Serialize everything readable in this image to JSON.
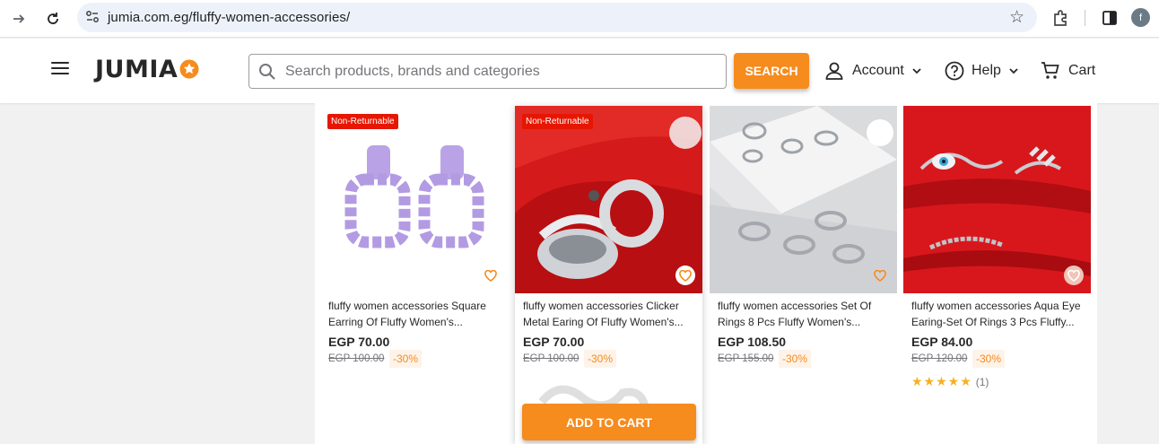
{
  "browser": {
    "url": "jumia.com.eg/fluffy-women-accessories/",
    "profile_initial": "f"
  },
  "header": {
    "logo_text": "JUMIA",
    "search_placeholder": "Search products, brands and categories",
    "search_button": "SEARCH",
    "account_label": "Account",
    "help_label": "Help",
    "cart_label": "Cart"
  },
  "colors": {
    "brand_orange": "#f68b1e",
    "badge_red": "#e61601",
    "text_dark": "#282828"
  },
  "products": [
    {
      "badge": "Non-Returnable",
      "name": "fluffy women accessories Square Earring Of Fluffy Women's...",
      "price": "EGP 70.00",
      "old_price": "EGP 100.00",
      "discount": "-30%"
    },
    {
      "badge": "Non-Returnable",
      "name": "fluffy women accessories Clicker Metal Earing Of Fluffy Women's...",
      "price": "EGP 70.00",
      "old_price": "EGP 100.00",
      "discount": "-30%",
      "add_to_cart": "ADD TO CART"
    },
    {
      "name": "fluffy women accessories Set Of Rings 8 Pcs Fluffy Women's...",
      "price": "EGP 108.50",
      "old_price": "EGP 155.00",
      "discount": "-30%"
    },
    {
      "name": "fluffy women accessories Aqua Eye Earing-Set Of Rings 3 Pcs Fluffy...",
      "price": "EGP 84.00",
      "old_price": "EGP 120.00",
      "discount": "-30%",
      "rating_stars": "★★★★★",
      "rating_count": "(1)"
    }
  ]
}
